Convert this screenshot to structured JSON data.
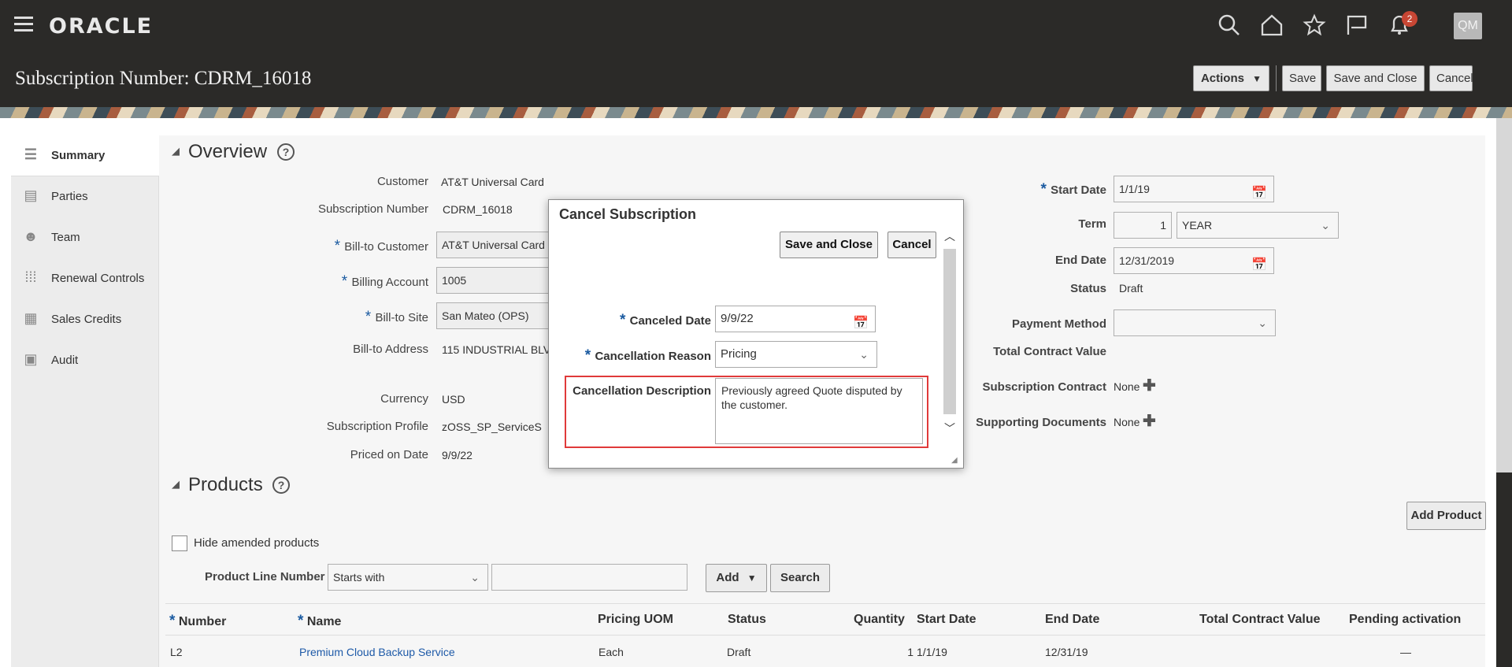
{
  "app": {
    "logo": "ORACLE",
    "user_initials": "QM",
    "notification_count": "2"
  },
  "header": {
    "title": "Subscription Number: CDRM_16018",
    "actions_label": "Actions",
    "save_label": "Save",
    "save_close_label": "Save and Close",
    "cancel_label": "Cancel"
  },
  "sidebar": {
    "items": [
      {
        "label": "Summary",
        "icon": "list-icon"
      },
      {
        "label": "Parties",
        "icon": "id-card-icon"
      },
      {
        "label": "Team",
        "icon": "people-icon"
      },
      {
        "label": "Renewal Controls",
        "icon": "sliders-icon"
      },
      {
        "label": "Sales Credits",
        "icon": "grid-icon"
      },
      {
        "label": "Audit",
        "icon": "audit-icon"
      }
    ]
  },
  "overview": {
    "title": "Overview",
    "customer_label": "Customer",
    "customer": "AT&T Universal Card",
    "sub_number_label": "Subscription Number",
    "sub_number": "CDRM_16018",
    "bill_to_customer_label": "Bill-to Customer",
    "bill_to_customer": "AT&T Universal Card",
    "billing_account_label": "Billing Account",
    "billing_account": "1005",
    "bill_to_site_label": "Bill-to Site",
    "bill_to_site": "San Mateo (OPS)",
    "bill_to_address_label": "Bill-to Address",
    "bill_to_address": "115 INDUSTRIAL BLV",
    "currency_label": "Currency",
    "currency": "USD",
    "profile_label": "Subscription Profile",
    "profile": "zOSS_SP_ServiceS",
    "priced_label": "Priced on Date",
    "priced": "9/9/22",
    "start_date_label": "Start Date",
    "start_date": "1/1/19",
    "term_label": "Term",
    "term_value": "1",
    "term_unit": "YEAR",
    "end_date_label": "End Date",
    "end_date": "12/31/2019",
    "status_label": "Status",
    "status": "Draft",
    "payment_label": "Payment Method",
    "payment": "",
    "tcv_label": "Total Contract Value",
    "contract_label": "Subscription Contract",
    "contract": "None",
    "docs_label": "Supporting Documents",
    "docs": "None"
  },
  "products": {
    "title": "Products",
    "add_product_label": "Add Product",
    "hide_amended_label": "Hide amended products",
    "line_number_label": "Product Line Number",
    "operator": "Starts with",
    "search_value": "",
    "add_label": "Add",
    "search_label": "Search",
    "columns": [
      "Number",
      "Name",
      "Pricing UOM",
      "Status",
      "Quantity",
      "Start Date",
      "End Date",
      "Total Contract Value",
      "Pending activation"
    ],
    "rows": [
      {
        "number": "L2",
        "name": "Premium Cloud Backup Service",
        "uom": "Each",
        "status": "Draft",
        "quantity": "1",
        "start": "1/1/19",
        "end": "12/31/19",
        "tcv": "",
        "pending": "—"
      }
    ]
  },
  "dialog": {
    "title": "Cancel Subscription",
    "save_close_label": "Save and Close",
    "cancel_label": "Cancel",
    "canceled_date_label": "Canceled Date",
    "canceled_date": "9/9/22",
    "reason_label": "Cancellation Reason",
    "reason": "Pricing",
    "description_label": "Cancellation Description",
    "description": "Previously agreed Quote disputed by the customer."
  },
  "colors": {
    "header_bg": "#2b2a28",
    "link": "#1e5aa8",
    "required": "#1a5aa0",
    "highlight": "#e03a3a",
    "badge": "#c74634"
  }
}
